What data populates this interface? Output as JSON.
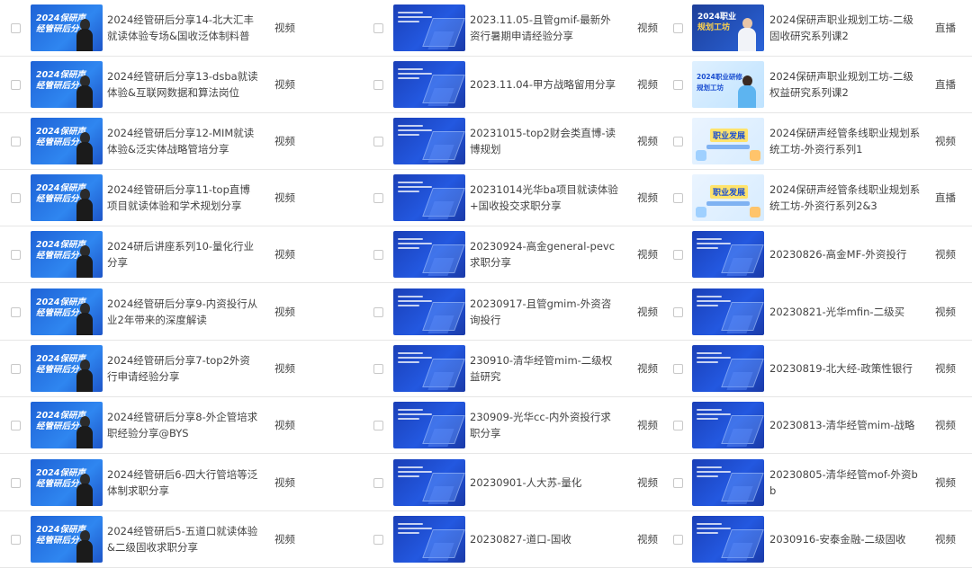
{
  "type_labels": {
    "video": "视频",
    "live": "直播"
  },
  "columns": [
    {
      "rows": [
        {
          "title": "2024经管研后分享14-北大汇丰就读体验专场&国收泛体制料普",
          "type": "视频",
          "thumb": "person"
        },
        {
          "title": "2024经管研后分享13-dsba就读体验&互联网数据和算法岗位",
          "type": "视频",
          "thumb": "person"
        },
        {
          "title": "2024经管研后分享12-MIM就读体验&泛实体战略管培分享",
          "type": "视频",
          "thumb": "person"
        },
        {
          "title": "2024经管研后分享11-top直博项目就读体验和学术规划分享",
          "type": "视频",
          "thumb": "person"
        },
        {
          "title": "2024研后讲座系列10-量化行业分享",
          "type": "视频",
          "thumb": "person"
        },
        {
          "title": "2024经管研后分享9-内资投行从业2年带来的深度解读",
          "type": "视频",
          "thumb": "person"
        },
        {
          "title": "2024经管研后分享7-top2外资行申请经验分享",
          "type": "视频",
          "thumb": "person"
        },
        {
          "title": "2024经管研后分享8-外企管培求职经验分享@BYS",
          "type": "视频",
          "thumb": "person"
        },
        {
          "title": "2024经管研后6-四大行管培等泛体制求职分享",
          "type": "视频",
          "thumb": "person"
        },
        {
          "title": "2024经管研后5-五道口就读体验&二级固收求职分享",
          "type": "视频",
          "thumb": "person"
        }
      ],
      "thumb_text_line1": "2024保研声",
      "thumb_text_line2": "经管研后分享"
    },
    {
      "rows": [
        {
          "title": "2023.11.05-且管gmif-最新外资行暑期申请经验分享",
          "type": "视频",
          "thumb": "dark"
        },
        {
          "title": "2023.11.04-甲方战略留用分享",
          "type": "视频",
          "thumb": "dark"
        },
        {
          "title": "20231015-top2财会类直博-读博规划",
          "type": "视频",
          "thumb": "dark"
        },
        {
          "title": "20231014光华ba项目就读体验+国收投交求职分享",
          "type": "视频",
          "thumb": "dark"
        },
        {
          "title": "20230924-高金general-pevc求职分享",
          "type": "视频",
          "thumb": "dark"
        },
        {
          "title": "20230917-且管gmim-外资咨询投行",
          "type": "视频",
          "thumb": "dark"
        },
        {
          "title": "230910-清华经管mim-二级权益研究",
          "type": "视频",
          "thumb": "dark"
        },
        {
          "title": "230909-光华cc-内外资投行求职分享",
          "type": "视频",
          "thumb": "dark"
        },
        {
          "title": "20230901-人大苏-量化",
          "type": "视频",
          "thumb": "dark"
        },
        {
          "title": "20230827-道口-国收",
          "type": "视频",
          "thumb": "dark"
        }
      ]
    },
    {
      "rows": [
        {
          "title": "2024保研声职业规划工坊-二级固收研究系列课2",
          "type": "直播",
          "thumb": "live1"
        },
        {
          "title": "2024保研声职业规划工坊-二级权益研究系列课2",
          "type": "直播",
          "thumb": "live2"
        },
        {
          "title": "2024保研声经管条线职业规划系统工坊-外资行系列1",
          "type": "视频",
          "thumb": "job"
        },
        {
          "title": "2024保研声经管条线职业规划系统工坊-外资行系列2&3",
          "type": "直播",
          "thumb": "job"
        },
        {
          "title": "20230826-高金MF-外资投行",
          "type": "视频",
          "thumb": "dark"
        },
        {
          "title": "20230821-光华mfin-二级买",
          "type": "视频",
          "thumb": "dark"
        },
        {
          "title": "20230819-北大经-政策性银行",
          "type": "视频",
          "thumb": "dark"
        },
        {
          "title": "20230813-清华经管mim-战略",
          "type": "视频",
          "thumb": "dark"
        },
        {
          "title": "20230805-清华经管mof-外资bb",
          "type": "视频",
          "thumb": "dark"
        },
        {
          "title": "2030916-安泰金融-二级固收",
          "type": "视频",
          "thumb": "dark"
        }
      ],
      "special_thumb_text": {
        "live1_line1": "2024职业",
        "live1_line2": "规划工坊",
        "live2_line1": "2024职业研修",
        "live2_line2": "规划工坊",
        "job": "职业发展"
      }
    }
  ],
  "colors": {
    "accent_blue": "#2358e0",
    "border": "#e6e6e6",
    "text": "#444444"
  }
}
